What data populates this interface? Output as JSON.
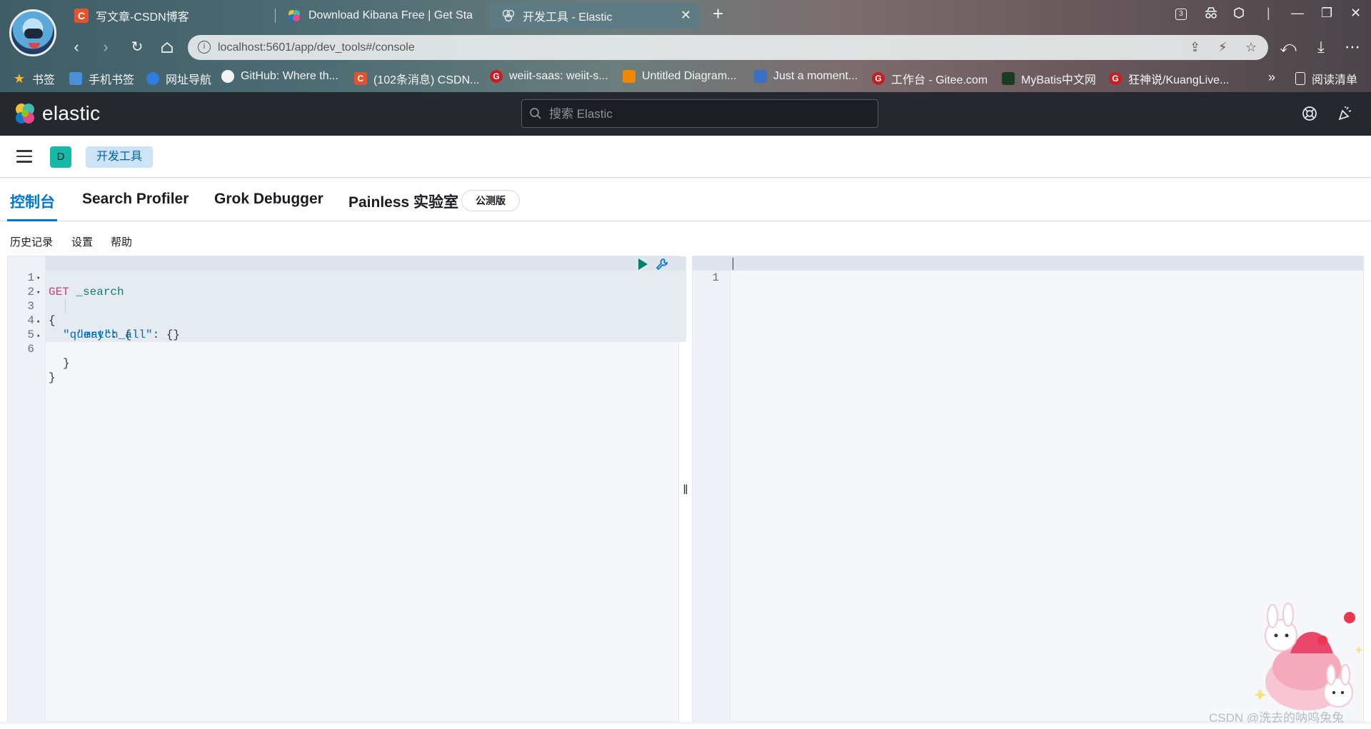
{
  "browser": {
    "tabs": [
      {
        "title": "写文章-CSDN博客",
        "icon": "csdn-c-icon",
        "color": "#e5532d"
      },
      {
        "title": "Download Kibana Free | Get Sta",
        "icon": "elastic-icon",
        "color": "#f3c12b"
      },
      {
        "title": "开发工具 - Elastic",
        "icon": "elastic-outline-icon",
        "color": "#aab8bf"
      }
    ],
    "address": {
      "url": "localhost:5601/app/dev_tools#/console"
    },
    "bookmarks": [
      {
        "label": "书签",
        "icon": "star-icon"
      },
      {
        "label": "手机书签",
        "icon": "phone-bookmark-icon"
      },
      {
        "label": "网址导航",
        "icon": "globe-icon"
      },
      {
        "label": "GitHub: Where th...",
        "icon": "github-icon"
      },
      {
        "label": "(102条消息) CSDN...",
        "icon": "csdn-c-icon"
      },
      {
        "label": "weiit-saas: weiit-s...",
        "icon": "gitee-icon"
      },
      {
        "label": "Untitled Diagram...",
        "icon": "diagram-icon"
      },
      {
        "label": "Just a moment...",
        "icon": "page-icon"
      },
      {
        "label": "工作台 - Gitee.com",
        "icon": "gitee-icon"
      },
      {
        "label": "MyBatis中文网",
        "icon": "leaf-icon"
      },
      {
        "label": "狂神说/KuangLive...",
        "icon": "gitee-icon"
      }
    ],
    "more_bookmarks": "»",
    "reading_list": "阅读清单",
    "tab_count": "3"
  },
  "kibana": {
    "brand": "elastic",
    "search_placeholder": "搜索 Elastic",
    "space_initial": "D",
    "breadcrumb": "开发工具"
  },
  "devtools": {
    "tabs": [
      "控制台",
      "Search Profiler",
      "Grok Debugger",
      "Painless 实验室"
    ],
    "beta_badge": "公测版",
    "menu": [
      "历史记录",
      "设置",
      "帮助"
    ]
  },
  "editor": {
    "lines": [
      {
        "no": "1",
        "text": "GET _search"
      },
      {
        "no": "2",
        "text": "{"
      },
      {
        "no": "3",
        "text": "\"query\": {"
      },
      {
        "no": "4",
        "text": "\"match_all\": {}"
      },
      {
        "no": "5",
        "text": "}"
      },
      {
        "no": "6",
        "text": "}"
      }
    ],
    "method": "GET",
    "path": "_search",
    "key_query": "\"query\"",
    "key_match_all": "\"match_all\"",
    "output_line_no": "1",
    "splitter": "‖"
  },
  "overlay": {
    "watermark": "CSDN @洗去的呐呜兔兔"
  },
  "colors": {
    "kibana_header": "#25282f",
    "accent": "#0077cc",
    "run": "#00806d"
  }
}
